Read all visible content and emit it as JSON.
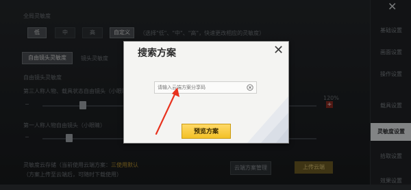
{
  "background": {
    "section1_title": "全局灵敏度",
    "sensitivity_options": [
      "低",
      "中",
      "高"
    ],
    "custom_button": "自定义",
    "sensitivity_hint": "（选择\"低\"、\"中\"、\"高\"，快速更改相应的灵敏度）",
    "tabs": [
      "自由镜头灵敏度",
      "镜头灵敏度"
    ],
    "subsection_title": "自由镜头灵敏度",
    "row1_label": "第三人称人物、载具状态自由镜头（小眼睛）",
    "row1_value": "120%",
    "row2_label": "第一人称人物自由镜头（小眼睛）",
    "cloud_title": "灵敏度云存储（当前使用云端方案：",
    "cloud_highlight": "三使用默认",
    "cloud_note": "（方案上传至云端后，可随时下载使用）",
    "cloud_manage_button": "云端方案管理",
    "upload_button": "上传云端",
    "sidebar": [
      "基础设置",
      "画面设置",
      "操作设置",
      "载具设置",
      "灵敏度设置",
      "拾取设置",
      "效果设置"
    ]
  },
  "dialog": {
    "title": "搜索方案",
    "search_placeholder": "请输入云端方案分享码",
    "preview_button": "预览方案"
  },
  "icons": {
    "close": "close-icon",
    "clear": "clear-circle-icon"
  },
  "colors": {
    "accent": "#f3c127",
    "active_tab": "#e1e3e5",
    "arrow": "#e8321e"
  }
}
